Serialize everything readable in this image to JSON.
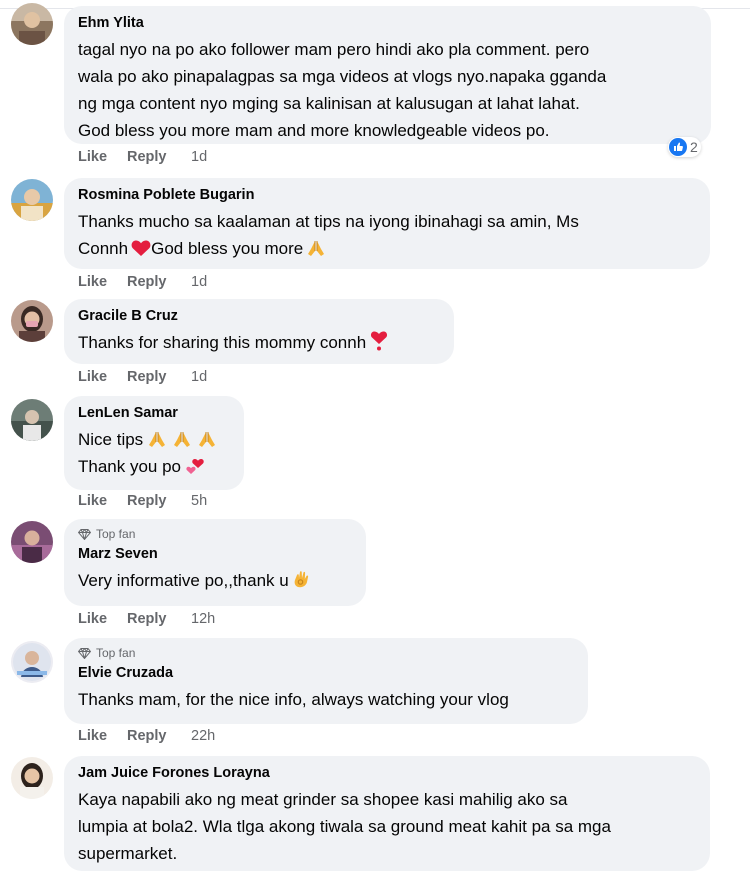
{
  "comments": [
    {
      "author": "Ehm Ylita",
      "lines": [
        "tagal nyo na po ako follower mam pero hindi ako pla comment. pero",
        "wala po ako pinapalagpas sa mga videos at vlogs nyo.napaka gganda",
        "ng mga content nyo mging sa kalinisan at kalusugan at lahat lahat.",
        "God bless you more mam and more knowledgeable videos po."
      ],
      "like": "Like",
      "reply": "Reply",
      "time": "1d",
      "reactions": "2",
      "reaction_icon": "like-reaction-icon"
    },
    {
      "author": "Rosmina Poblete Bugarin",
      "lines": [
        "Thanks mucho sa kaalaman at tips na iyong ibinahagi sa amin, Ms",
        "Connh",
        "God bless you more"
      ],
      "like": "Like",
      "reply": "Reply",
      "time": "1d"
    },
    {
      "author": "Gracile B Cruz",
      "lines": [
        "Thanks for sharing this mommy connh"
      ],
      "like": "Like",
      "reply": "Reply",
      "time": "1d"
    },
    {
      "author": "LenLen Samar",
      "lines": [
        "Nice tips",
        "Thank you po"
      ],
      "like": "Like",
      "reply": "Reply",
      "time": "5h"
    },
    {
      "badge": "Top fan",
      "author": "Marz Seven",
      "lines": [
        "Very informative po,,thank u"
      ],
      "like": "Like",
      "reply": "Reply",
      "time": "12h"
    },
    {
      "badge": "Top fan",
      "author": "Elvie Cruzada",
      "lines": [
        "Thanks mam, for the nice info, always watching your vlog"
      ],
      "like": "Like",
      "reply": "Reply",
      "time": "22h"
    },
    {
      "author": "Jam Juice Forones Lorayna",
      "lines": [
        "Kaya napabili ako ng meat grinder sa shopee kasi mahilig ako sa",
        "lumpia at bola2. Wla tlga akong tiwala sa ground meat kahit pa sa mga",
        "supermarket."
      ]
    }
  ],
  "colors": {
    "bubble": "#f0f2f5",
    "meta": "#65676b",
    "text": "#050505",
    "like_blue": "#1877f2",
    "heart_red": "#e41e3f"
  }
}
